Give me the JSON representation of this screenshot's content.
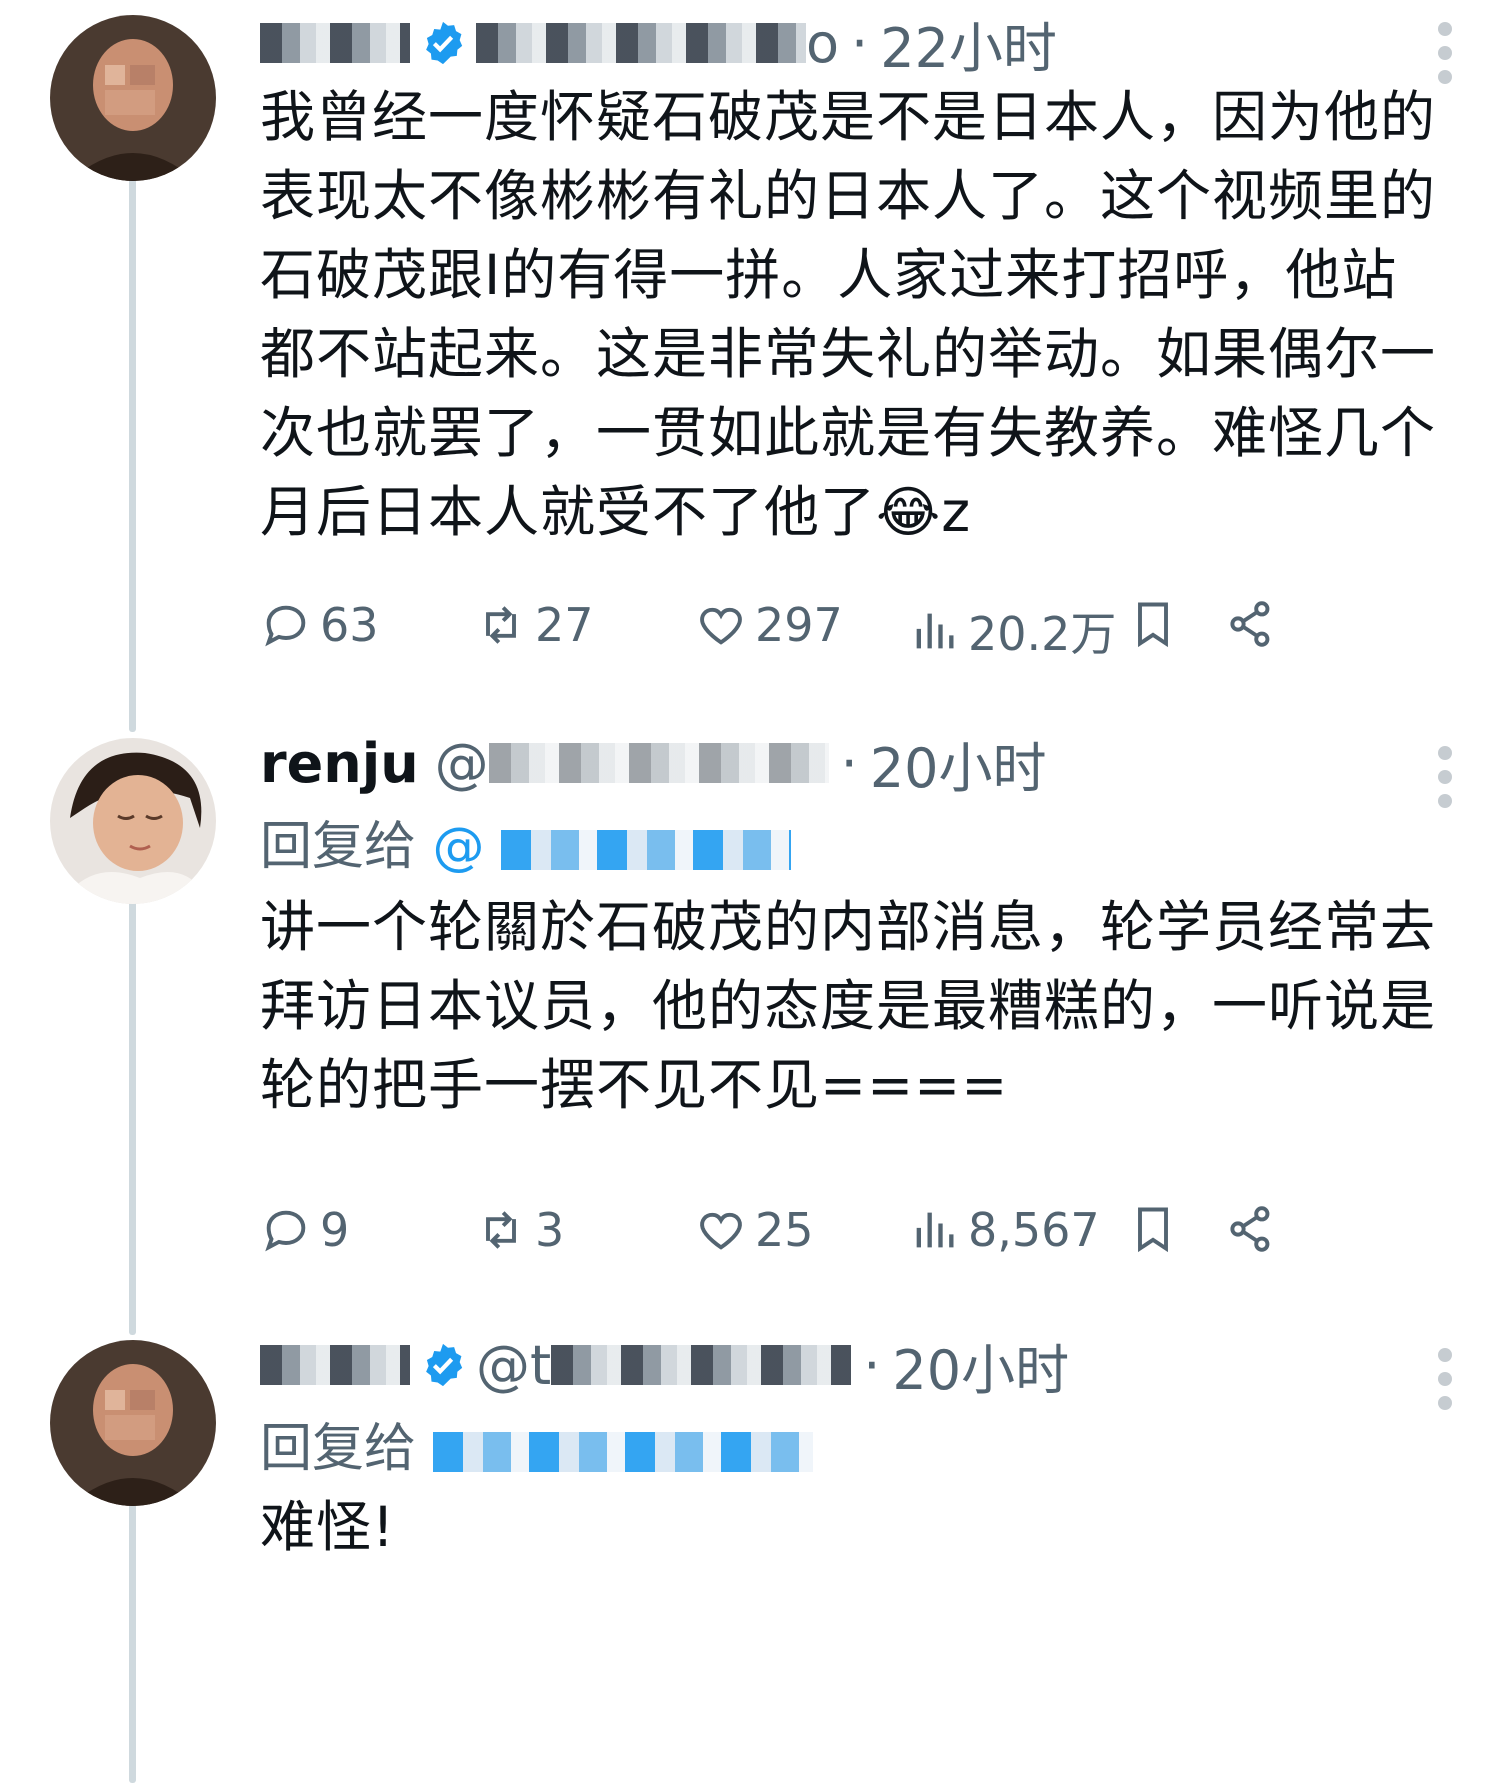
{
  "colors": {
    "text": "#0f1419",
    "secondary": "#536471",
    "accent": "#1d9bf0",
    "thread_line": "#cfd9de"
  },
  "tweets": [
    {
      "name": "",
      "handle": "o",
      "time": "22小时",
      "verified": true,
      "reply_to": "",
      "text": "我曾经一度怀疑石破茂是不是日本人，因为他的表现太不像彬彬有礼的日本人了。这个视频里的石破茂跟I的有得一拼。人家过来打招呼，他站都不站起来。这是非常失礼的举动。如果偶尔一次也就罢了，一贯如此就是有失教养。难怪几个月后日本人就受不了他了😂z",
      "replies": "63",
      "retweets": "27",
      "likes": "297",
      "views": "20.2万",
      "icons": [
        "reply-icon",
        "retweet-icon",
        "like-icon",
        "views-icon",
        "bookmark-icon",
        "share-icon",
        "more-icon"
      ]
    },
    {
      "name": "renju",
      "handle": "@",
      "time": "20小时",
      "verified": false,
      "reply_prefix": "回复给",
      "reply_to": "@",
      "text": "讲一个轮關於石破茂的内部消息，轮学员经常去拜访日本议员，他的态度是最糟糕的，一听说是轮的把手一摆不见不见====",
      "replies": "9",
      "retweets": "3",
      "likes": "25",
      "views": "8,567"
    },
    {
      "name": "",
      "handle": "@t",
      "time": "20小时",
      "verified": true,
      "reply_prefix": "回复给",
      "reply_to": "",
      "text": "难怪!"
    }
  ]
}
